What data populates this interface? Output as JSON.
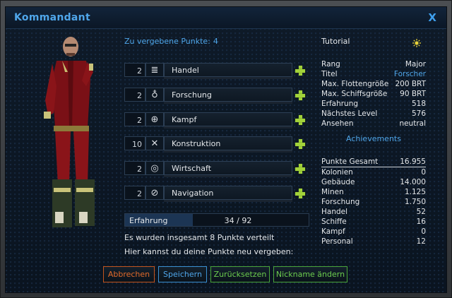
{
  "window": {
    "title": "Kommandant",
    "close_label": "X"
  },
  "points": {
    "label": "Zu vergebene Punkte:",
    "value": "4"
  },
  "skills": [
    {
      "value": "2",
      "icon": "book-icon",
      "name": "Handel",
      "progress": 0.0
    },
    {
      "value": "2",
      "icon": "lightbulb-icon",
      "name": "Forschung",
      "progress": 0.0
    },
    {
      "value": "2",
      "icon": "crosshair-icon",
      "name": "Kampf",
      "progress": 0.0
    },
    {
      "value": "10",
      "icon": "tools-icon",
      "name": "Konstruktion",
      "progress": 0.0
    },
    {
      "value": "2",
      "icon": "coins-icon",
      "name": "Wirtschaft",
      "progress": 0.0
    },
    {
      "value": "2",
      "icon": "compass-icon",
      "name": "Navigation",
      "progress": 0.0
    }
  ],
  "experience": {
    "label": "Erfahrung",
    "value": "34 / 92",
    "fraction": 0.37
  },
  "info": {
    "distributed": "Es wurden insgesamt 8 Punkte verteilt",
    "redistribute": "Hier kannst du deine Punkte neu vergeben:"
  },
  "tutorial": {
    "label": "Tutorial",
    "icon": "sun-icon"
  },
  "stats": [
    {
      "key": "Rang",
      "value": "Major"
    },
    {
      "key": "Titel",
      "value": "Forscher",
      "highlight": true
    },
    {
      "key": "Max. Flottengröße",
      "value": "200 BRT"
    },
    {
      "key": "Max. Schiffsgröße",
      "value": "90 BRT"
    },
    {
      "key": "Erfahrung",
      "value": "518"
    },
    {
      "key": "Nächstes Level",
      "value": "576"
    },
    {
      "key": "Ansehen",
      "value": "neutral"
    }
  ],
  "achievements_label": "Achievements",
  "achievements": [
    {
      "key": "Punkte Gesamt",
      "value": "16.955"
    },
    {
      "key": "Kolonien",
      "value": "0"
    },
    {
      "key": "Gebäude",
      "value": "14.000"
    },
    {
      "key": "Minen",
      "value": "1.125"
    },
    {
      "key": "Forschung",
      "value": "1.750"
    },
    {
      "key": "Handel",
      "value": "52"
    },
    {
      "key": "Schiffe",
      "value": "16"
    },
    {
      "key": "Kampf",
      "value": "0"
    },
    {
      "key": "Personal",
      "value": "12"
    }
  ],
  "buttons": {
    "cancel": "Abbrechen",
    "save": "Speichern",
    "reset": "Zurücksetzen",
    "rename": "Nickname ändern"
  },
  "colors": {
    "accent": "#4fa6ea",
    "plus": "#a2d23a",
    "cancel": "#e06a2a",
    "ok": "#6ccc4e"
  }
}
